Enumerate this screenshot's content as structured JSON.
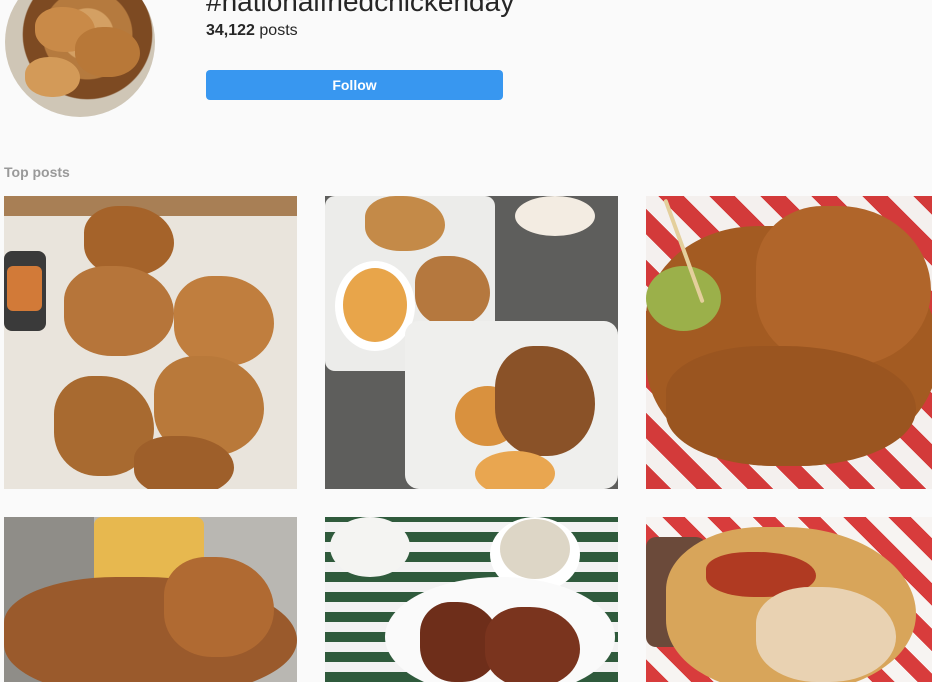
{
  "header": {
    "hashtag": "#nationalfriedchickenday",
    "post_count": "34,122",
    "post_count_suffix": "posts",
    "follow_label": "Follow"
  },
  "top_posts": {
    "label": "Top posts",
    "items": [
      {
        "subject": "fried chicken bites with dipping sauce"
      },
      {
        "subject": "fried chicken with mac and cheese in takeout boxes"
      },
      {
        "subject": "hot chicken with pickle on checkered paper"
      },
      {
        "subject": "fried chicken with cornbread on metal tray"
      },
      {
        "subject": "fried chicken with coleslaw on checkered table"
      },
      {
        "subject": "chicken sandwich with bacon on checkered paper"
      }
    ]
  },
  "colors": {
    "accent": "#3897f0",
    "background": "#fafafa",
    "text": "#262626",
    "muted": "#999999"
  }
}
